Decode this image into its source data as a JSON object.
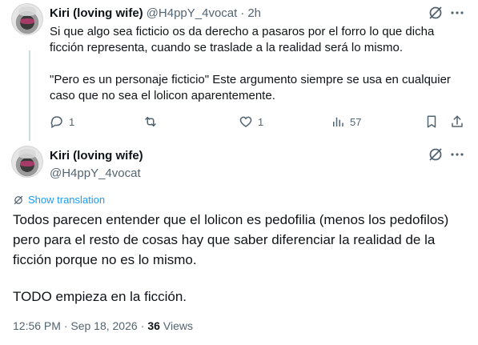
{
  "reply": {
    "author_name": "Kiri (loving wife)",
    "handle": "@H4ppY_4vocat",
    "separator": "·",
    "time": "2h",
    "paragraph1": "Si que algo sea ficticio os da derecho a pasaros por el forro lo que dicha ficción representa, cuando se traslade a la realidad será lo mismo.",
    "paragraph2": "\"Pero es un personaje ficticio\" Este argumento siempre se usa en cualquier caso que no sea el lolicon aparentemente.",
    "reply_count": "1",
    "retweet_count": "",
    "like_count": "1",
    "view_count": "57"
  },
  "main": {
    "author_name": "Kiri (loving wife)",
    "handle": "@H4ppY_4vocat",
    "show_translation": "Show translation",
    "paragraph1": "Todos parecen entender que el lolicon es pedofilia (menos los pedofilos) pero para el resto de cosas hay que saber diferenciar la realidad de la ficción porque no es lo mismo.",
    "paragraph2": "TODO empieza en la ficción.",
    "timestamp": "12:56 PM · Sep 18, 2026",
    "views_separator": "·",
    "views_count": "36",
    "views_label": "Views"
  },
  "colors": {
    "text": "#0f1419",
    "muted": "#536471",
    "link": "#1d9bf0",
    "line": "#cfd9de"
  },
  "icons": [
    "grok-icon",
    "more-icon",
    "reply-icon",
    "retweet-icon",
    "like-icon",
    "views-icon",
    "bookmark-icon",
    "share-icon",
    "translate-icon"
  ]
}
